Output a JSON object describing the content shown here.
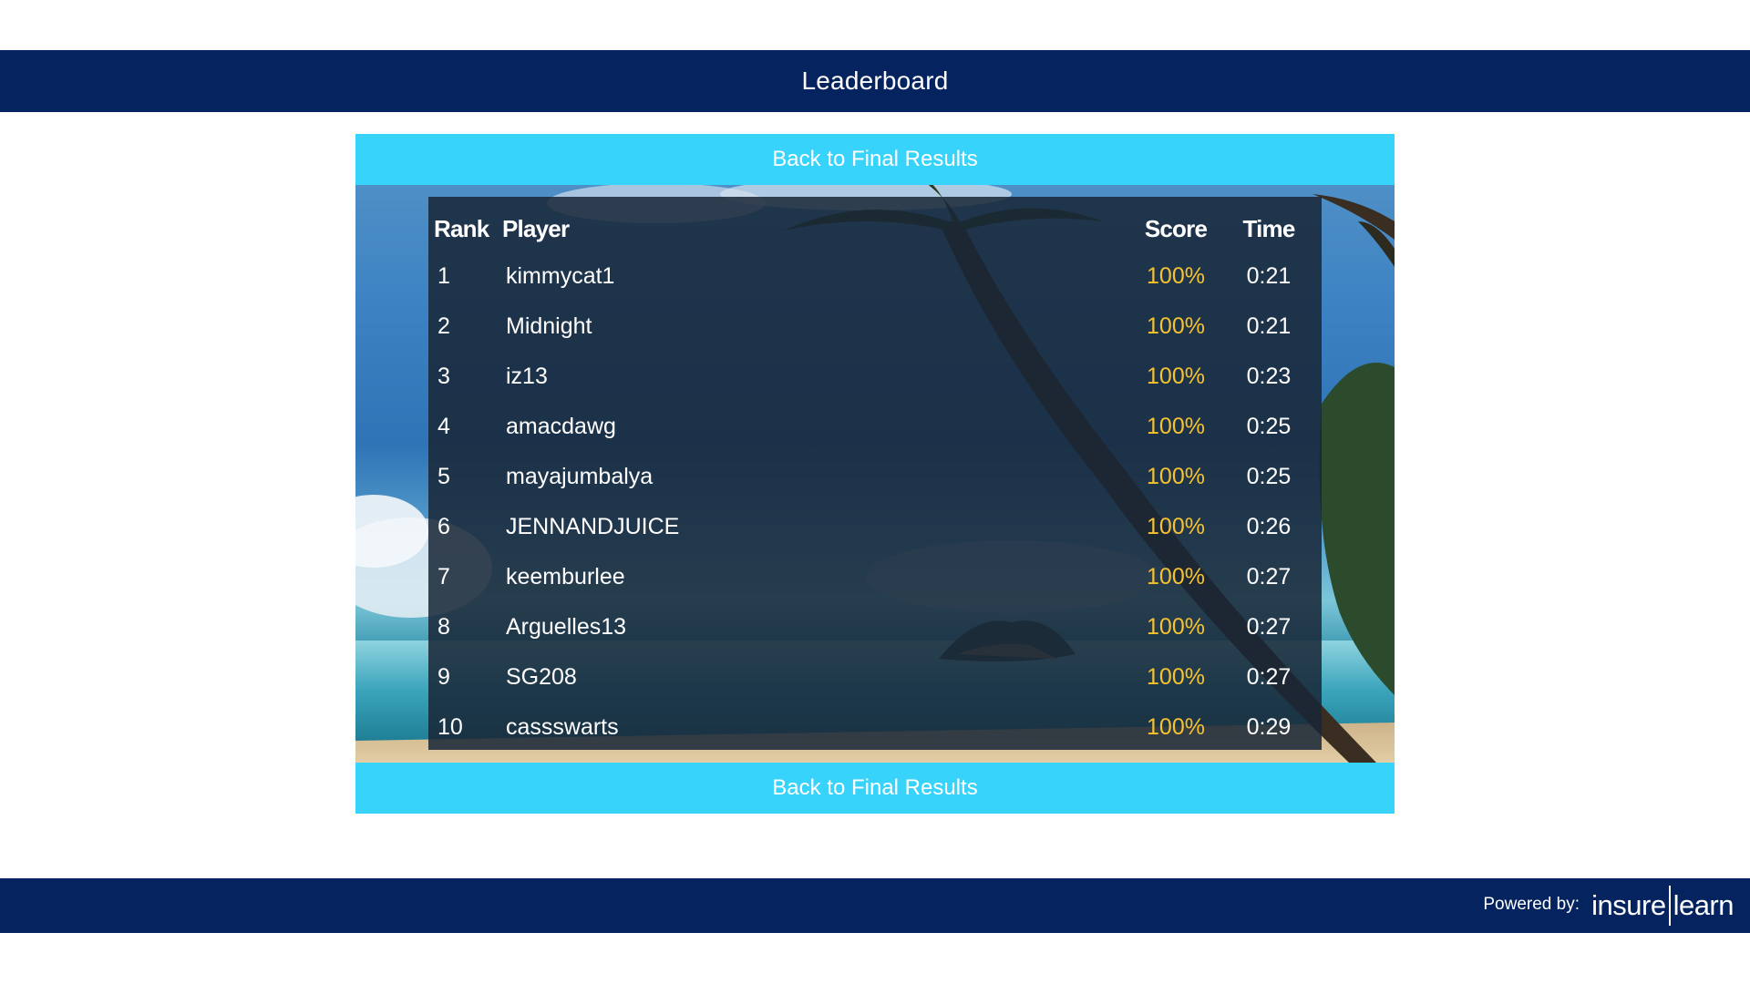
{
  "header": {
    "title": "Leaderboard"
  },
  "buttons": {
    "back_top": "Back to Final Results",
    "back_bottom": "Back to Final Results"
  },
  "table": {
    "columns": {
      "rank": "Rank",
      "player": "Player",
      "score": "Score",
      "time": "Time"
    },
    "rows": [
      {
        "rank": "1",
        "player": "kimmycat1",
        "score": "100%",
        "time": "0:21"
      },
      {
        "rank": "2",
        "player": "Midnight",
        "score": "100%",
        "time": "0:21"
      },
      {
        "rank": "3",
        "player": "iz13",
        "score": "100%",
        "time": "0:23"
      },
      {
        "rank": "4",
        "player": "amacdawg",
        "score": "100%",
        "time": "0:25"
      },
      {
        "rank": "5",
        "player": "mayajumbalya",
        "score": "100%",
        "time": "0:25"
      },
      {
        "rank": "6",
        "player": "JENNANDJUICE",
        "score": "100%",
        "time": "0:26"
      },
      {
        "rank": "7",
        "player": "keemburlee",
        "score": "100%",
        "time": "0:27"
      },
      {
        "rank": "8",
        "player": "Arguelles13",
        "score": "100%",
        "time": "0:27"
      },
      {
        "rank": "9",
        "player": "SG208",
        "score": "100%",
        "time": "0:27"
      },
      {
        "rank": "10",
        "player": "cassswarts",
        "score": "100%",
        "time": "0:29"
      }
    ]
  },
  "footer": {
    "powered_label": "Powered by:",
    "brand_left": "insure",
    "brand_right": "learn"
  },
  "colors": {
    "header_bg": "#04235f",
    "button_bg": "#38d3fb",
    "score_text": "#f6c230",
    "board_bg": "#192637"
  },
  "icons": {
    "background": "tropical-beach-image"
  }
}
